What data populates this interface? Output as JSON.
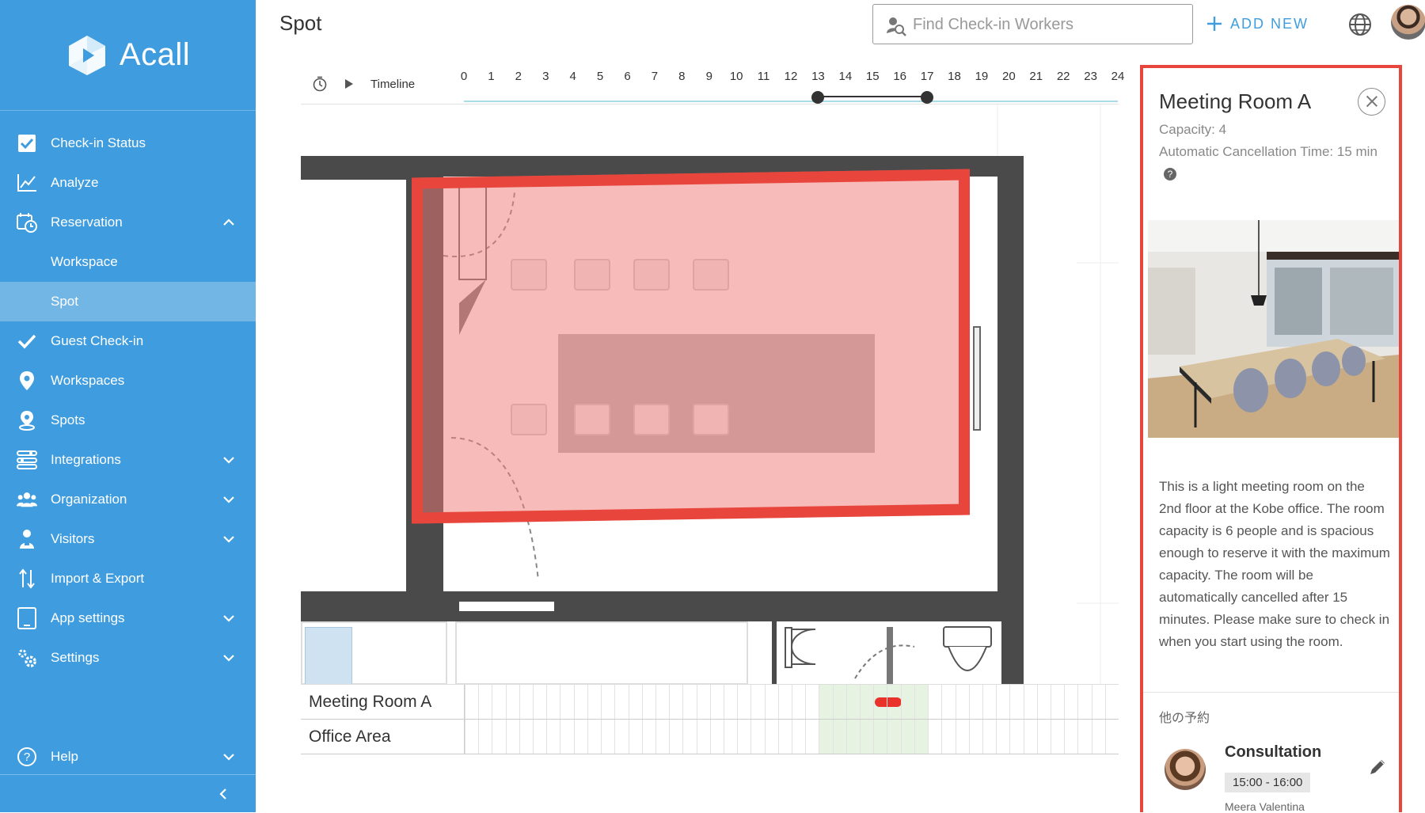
{
  "app": {
    "name": "Acall",
    "brand_color": "#3f9ddf",
    "highlight_color": "#e8463c"
  },
  "sidebar": {
    "items": [
      {
        "label": "Check-in Status",
        "icon": "checkbox-icon"
      },
      {
        "label": "Analyze",
        "icon": "line-chart-icon"
      },
      {
        "label": "Reservation",
        "icon": "calendar-clock-icon",
        "expanded": true
      },
      {
        "label": "Workspace",
        "sub": true
      },
      {
        "label": "Spot",
        "sub": true,
        "active": true
      },
      {
        "label": "Guest Check-in",
        "icon": "checkmark-icon"
      },
      {
        "label": "Workspaces",
        "icon": "location-pin-icon"
      },
      {
        "label": "Spots",
        "icon": "spot-pin-icon"
      },
      {
        "label": "Integrations",
        "icon": "integrations-icon"
      },
      {
        "label": "Organization",
        "icon": "people-icon"
      },
      {
        "label": "Visitors",
        "icon": "visitor-icon"
      },
      {
        "label": "Import & Export",
        "icon": "import-export-icon"
      },
      {
        "label": "App settings",
        "icon": "tablet-icon"
      },
      {
        "label": "Settings",
        "icon": "gears-icon"
      },
      {
        "label": "Help",
        "icon": "help-icon"
      }
    ]
  },
  "header": {
    "title": "Spot",
    "search_placeholder": "Find Check-in Workers",
    "add_new_label": "ADD NEW"
  },
  "timeline": {
    "label": "Timeline",
    "hours": [
      "0",
      "1",
      "2",
      "3",
      "4",
      "5",
      "6",
      "7",
      "8",
      "9",
      "10",
      "11",
      "12",
      "13",
      "14",
      "15",
      "16",
      "17",
      "18",
      "19",
      "20",
      "21",
      "22",
      "23",
      "24"
    ],
    "selected_start_hour": 13,
    "selected_end_hour": 17
  },
  "rows": [
    {
      "name": "Meeting Room A",
      "reservation_hour": 15
    },
    {
      "name": "Office Area"
    }
  ],
  "panel": {
    "title": "Meeting Room A",
    "capacity": "Capacity: 4",
    "auto_cancel": "Automatic Cancellation Time: 15 min",
    "description": "This is a light meeting room on the 2nd floor at the Kobe office. The room capacity is 6 people and is spacious enough to reserve it with the maximum capacity. The room will be automatically cancelled after 15 minutes. Please make sure to check in when you start using the room.",
    "other_reservations_label": "他の予約",
    "reservation": {
      "title": "Consultation",
      "time": "15:00 - 16:00",
      "user": "Meera Valentina"
    }
  }
}
